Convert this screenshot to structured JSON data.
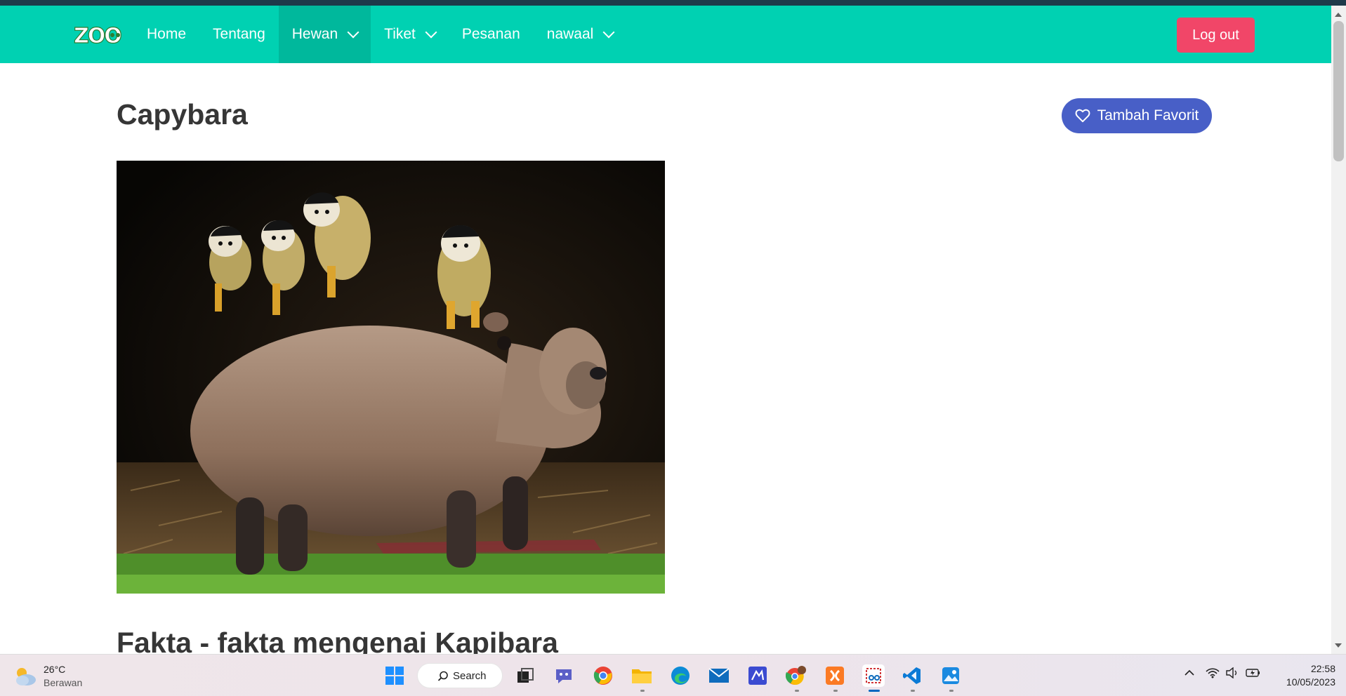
{
  "navbar": {
    "logo_text": "ZOO",
    "items": [
      {
        "label": "Home",
        "has_dropdown": false,
        "active": false
      },
      {
        "label": "Tentang",
        "has_dropdown": false,
        "active": false
      },
      {
        "label": "Hewan",
        "has_dropdown": true,
        "active": true
      },
      {
        "label": "Tiket",
        "has_dropdown": true,
        "active": false
      },
      {
        "label": "Pesanan",
        "has_dropdown": false,
        "active": false
      },
      {
        "label": "nawaal",
        "has_dropdown": true,
        "active": false
      }
    ],
    "logout_label": "Log out",
    "color": "#00d1b2"
  },
  "content": {
    "title": "Capybara",
    "favorite_label": "Tambah Favorit",
    "favorite_icon": "heart-outline-icon",
    "image_alt": "capybara-with-squirrel-monkeys-photo",
    "section_heading": "Fakta - fakta mengenai Kapibara"
  },
  "taskbar": {
    "weather_temp": "26°C",
    "weather_desc": "Berawan",
    "search_label": "Search",
    "time": "22:58",
    "date": "10/05/2023",
    "apps": [
      "windows-start-icon",
      "task-view-icon",
      "teams-chat-icon",
      "chrome-icon",
      "file-explorer-icon",
      "edge-icon",
      "mail-icon",
      "vscode-like-icon",
      "chrome-profile-icon",
      "xampp-icon",
      "snipping-tool-icon",
      "vscode-icon",
      "photos-icon"
    ]
  }
}
